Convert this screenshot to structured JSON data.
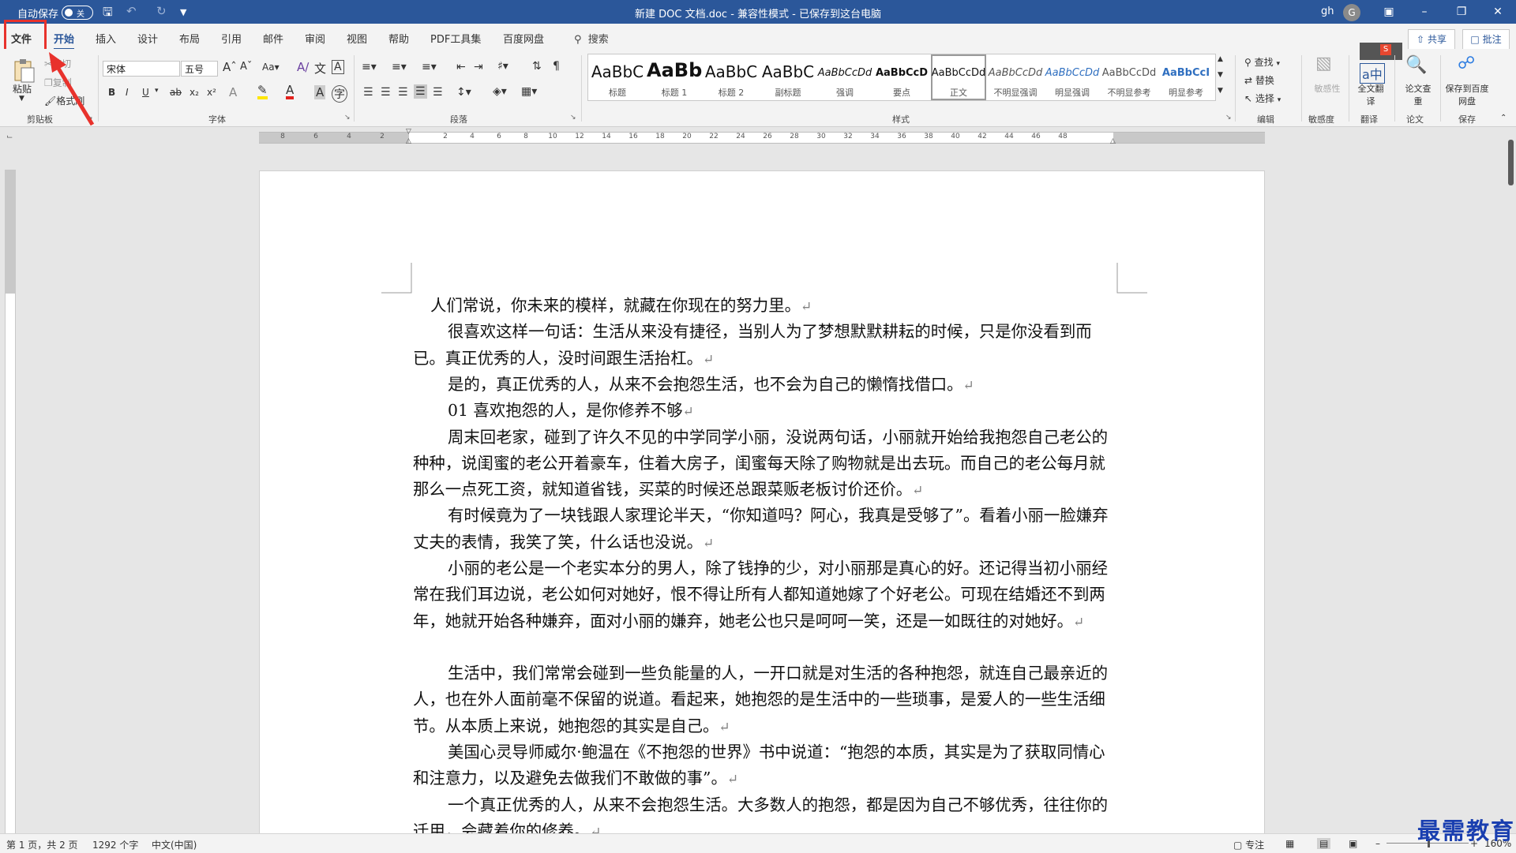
{
  "titlebar": {
    "autosave_label": "自动保存",
    "autosave_state": "关",
    "title": "新建 DOC 文档.doc  -  兼容性模式  -  已保存到这台电脑",
    "user_initials": "gh",
    "avatar_letter": "G"
  },
  "tabs": [
    "文件",
    "开始",
    "插入",
    "设计",
    "布局",
    "引用",
    "邮件",
    "审阅",
    "视图",
    "帮助",
    "PDF工具集",
    "百度网盘"
  ],
  "active_tab": "开始",
  "search_label": "搜索",
  "share_label": "共享",
  "comment_label": "批注",
  "clipboard": {
    "paste": "粘贴",
    "cut": "剪切",
    "copy": "复制",
    "format_painter": "格式刷",
    "group": "剪贴板"
  },
  "font": {
    "name": "宋体",
    "size": "五号",
    "group": "字体"
  },
  "paragraph_group": "段落",
  "styles": {
    "group": "样式",
    "items": [
      {
        "preview": "AaBbC",
        "name": "标题"
      },
      {
        "preview": "AaBb",
        "name": "标题 1"
      },
      {
        "preview": "AaBbC",
        "name": "标题 2"
      },
      {
        "preview": "AaBbC",
        "name": "副标题"
      },
      {
        "preview": "AaBbCcDd",
        "name": "强调"
      },
      {
        "preview": "AaBbCcD",
        "name": "要点"
      },
      {
        "preview": "AaBbCcDd",
        "name": "正文"
      },
      {
        "preview": "AaBbCcDd",
        "name": "不明显强调"
      },
      {
        "preview": "AaBbCcDd",
        "name": "明显强调"
      },
      {
        "preview": "AaBbCcDd",
        "name": "不明显参考"
      },
      {
        "preview": "AaBbCcI",
        "name": "明显参考"
      }
    ],
    "selected": "正文"
  },
  "editing": {
    "find": "查找",
    "replace": "替换",
    "select": "选择",
    "group": "编辑"
  },
  "sensitivity": {
    "button": "敏感性",
    "group": "敏感度"
  },
  "translate": {
    "button": "全文翻译",
    "group": "翻译"
  },
  "paper": {
    "button": "论文查重",
    "group": "论文"
  },
  "save": {
    "button": "保存到百度网盘",
    "group": "保存"
  },
  "ruler_numbers": [
    "8",
    "6",
    "4",
    "2",
    "2",
    "4",
    "6",
    "8",
    "10",
    "12",
    "14",
    "16",
    "18",
    "20",
    "22",
    "24",
    "26",
    "28",
    "30",
    "32",
    "34",
    "36",
    "38",
    "40",
    "42",
    "44",
    "46",
    "48"
  ],
  "paragraphs": [
    "人们常说，你未来的模样，就藏在你现在的努力里。",
    "很喜欢这样一句话：生活从来没有捷径，当别人为了梦想默默耕耘的时候，只是你没看到而已。真正优秀的人，没时间跟生活抬杠。",
    "是的，真正优秀的人，从来不会抱怨生活，也不会为自己的懒惰找借口。",
    "01  喜欢抱怨的人，是你修养不够",
    "周末回老家，碰到了许久不见的中学同学小丽，没说两句话，小丽就开始给我抱怨自己老公的种种，说闺蜜的老公开着豪车，住着大房子，闺蜜每天除了购物就是出去玩。而自己的老公每月就那么一点死工资，就知道省钱，买菜的时候还总跟菜贩老板讨价还价。",
    "有时候竟为了一块钱跟人家理论半天，“你知道吗？阿心，我真是受够了”。看着小丽一脸嫌弃丈夫的表情，我笑了笑，什么话也没说。",
    "小丽的老公是一个老实本分的男人，除了钱挣的少，对小丽那是真心的好。还记得当初小丽经常在我们耳边说，老公如何对她好，恨不得让所有人都知道她嫁了个好老公。可现在结婚还不到两年，她就开始各种嫌弃，面对小丽的嫌弃，她老公也只是呵呵一笑，还是一如既往的对她好。",
    "生活中，我们常常会碰到一些负能量的人，一开口就是对生活的各种抱怨，就连自己最亲近的人，也在外人面前毫不保留的说道。看起来，她抱怨的是生活中的一些琐事，是爱人的一些生活细节。从本质上来说，她抱怨的其实是自己。",
    "美国心灵导师威尔·鲍温在《不抱怨的世界》书中说道：“抱怨的本质，其实是为了获取同情心和注意力，以及避免去做我们不敢做的事”。",
    "一个真正优秀的人，从来不会抱怨生活。大多数人的抱怨，都是因为自己不够优秀，往往你的迁用，会藏着你的修养。"
  ],
  "status": {
    "page": "第 1 页，共 2 页",
    "words": "1292 个字",
    "language": "中文(中国)",
    "focus": "专注",
    "zoom": "160%"
  },
  "watermark": "最需教育",
  "colors": {
    "accent": "#2b579a",
    "highlight": "#e8322c"
  }
}
